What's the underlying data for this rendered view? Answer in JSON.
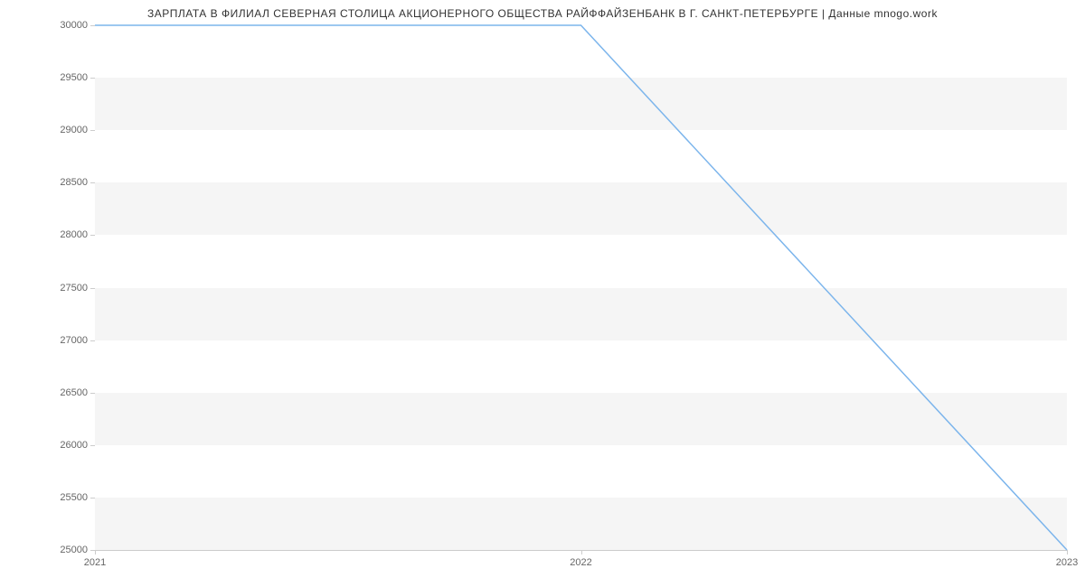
{
  "chart_data": {
    "type": "line",
    "title": "ЗАРПЛАТА В ФИЛИАЛ СЕВЕРНАЯ СТОЛИЦА АКЦИОНЕРНОГО ОБЩЕСТВА РАЙФФАЙЗЕНБАНК В Г. САНКТ-ПЕТЕРБУРГЕ | Данные mnogo.work",
    "x": [
      2021,
      2022,
      2023
    ],
    "values": [
      30000,
      30000,
      25000
    ],
    "xlabel": "",
    "ylabel": "",
    "xlim": [
      2021,
      2023
    ],
    "ylim": [
      25000,
      30000
    ],
    "y_ticks": [
      25000,
      25500,
      26000,
      26500,
      27000,
      27500,
      28000,
      28500,
      29000,
      29500,
      30000
    ],
    "x_ticks": [
      2021,
      2022,
      2023
    ],
    "line_color": "#7cb5ec"
  }
}
